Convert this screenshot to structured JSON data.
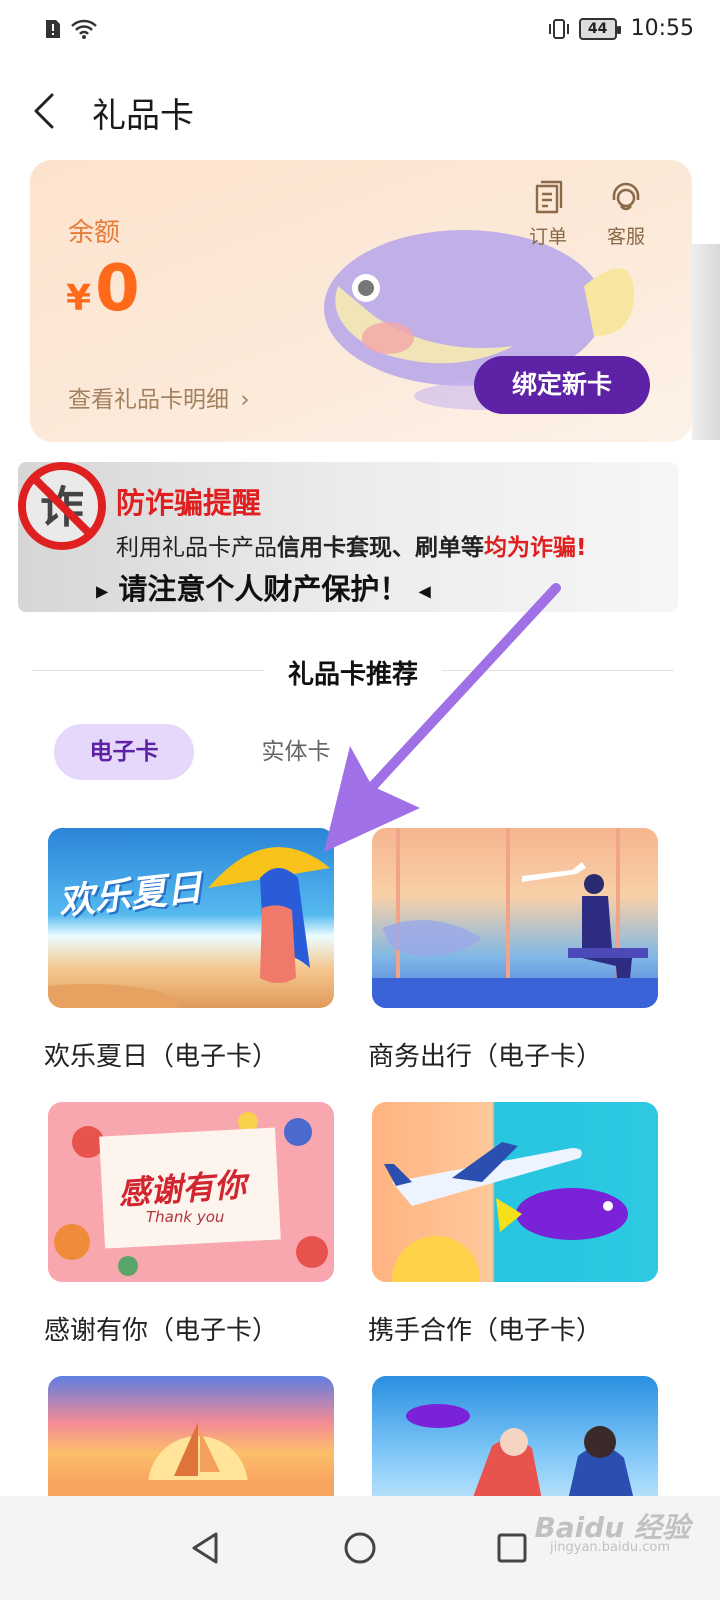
{
  "status_bar": {
    "time": "10:55",
    "battery": "44"
  },
  "header": {
    "title": "礼品卡"
  },
  "balance_card": {
    "label": "余额",
    "currency": "¥",
    "amount": "0",
    "detail_link": "查看礼品卡明细",
    "orders_label": "订单",
    "service_label": "客服",
    "bind_button": "绑定新卡"
  },
  "fraud_banner": {
    "badge": "诈",
    "title": "防诈骗提醒",
    "line_prefix": "利用礼品卡产品",
    "line_bold": "信用卡套现、刷单等",
    "line_red": "均为诈骗!",
    "warning": "请注意个人财产保护！"
  },
  "section": {
    "title": "礼品卡推荐"
  },
  "tabs": [
    {
      "label": "电子卡",
      "active": true
    },
    {
      "label": "实体卡",
      "active": false
    }
  ],
  "cards": [
    {
      "title": "欢乐夏日（电子卡）",
      "image_text": "欢乐夏日"
    },
    {
      "title": "商务出行（电子卡）"
    },
    {
      "title": "感谢有你（电子卡）",
      "image_text": "感谢有你",
      "image_subtext": "Thank you"
    },
    {
      "title": "携手合作（电子卡）"
    },
    {
      "title": ""
    },
    {
      "title": ""
    }
  ],
  "watermark": {
    "text": "Baidu 经验",
    "sub": "jingyan.baidu.com"
  },
  "colors": {
    "accent": "#5d22a5",
    "balance": "#ff6a1a",
    "alert": "#e02020",
    "annotation_arrow": "#a070e6"
  }
}
